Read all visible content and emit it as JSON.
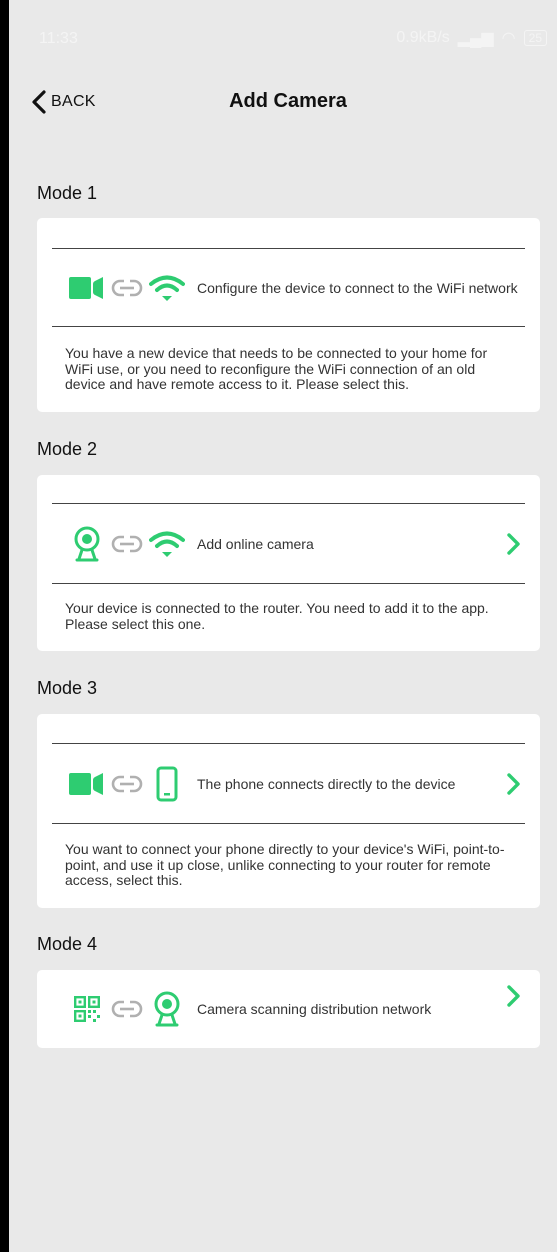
{
  "status_bar": {
    "time": "11:33",
    "speed": "0.9kB/s",
    "battery": "25"
  },
  "nav": {
    "back_label": "BACK",
    "title": "Add Camera"
  },
  "colors": {
    "accent": "#2ecc71",
    "link": "#b0b0b0"
  },
  "modes": [
    {
      "heading": "Mode 1",
      "icons": [
        "video-camera-icon",
        "link-icon",
        "wifi-icon"
      ],
      "label": "Configure the device to connect to the WiFi network",
      "description": "You have a new device that needs to be connected to your home for WiFi use, or you need to reconfigure the WiFi connection of an old device and have remote access to it. Please select this."
    },
    {
      "heading": "Mode 2",
      "icons": [
        "webcam-icon",
        "link-icon",
        "wifi-icon"
      ],
      "label": "Add online camera",
      "description": "Your device is connected to the router. You need to add it to the app. Please select this one."
    },
    {
      "heading": "Mode 3",
      "icons": [
        "video-camera-icon",
        "link-icon",
        "phone-icon"
      ],
      "label": "The phone connects directly to the device",
      "description": "You want to connect your phone directly to your device's WiFi, point-to-point, and use it up close, unlike connecting to your router for remote access, select this."
    },
    {
      "heading": "Mode 4",
      "icons": [
        "qr-code-icon",
        "link-icon",
        "webcam-icon"
      ],
      "label": "Camera scanning distribution network"
    }
  ]
}
